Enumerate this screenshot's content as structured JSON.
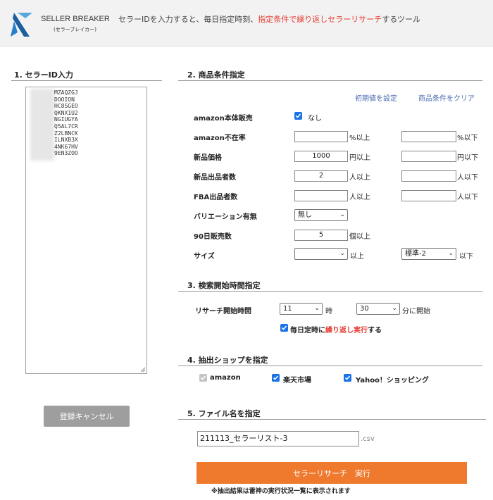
{
  "header": {
    "brand": "SELLER BREAKER",
    "brand_sub": "(セラーブレイカー)",
    "tagline_pre": "セラーIDを入力すると、毎日指定時刻、",
    "tagline_highlight": "指定条件で繰り返しセラーリサーチ",
    "tagline_post": "するツール",
    "accent_color": "#e53a2f"
  },
  "section1": {
    "title": "1. セラーID入力",
    "seller_ids": [
      "MZAQZGJ",
      "DOOION",
      "HC8SGEO",
      "QKNX1U2",
      "NGIUGYA",
      "Q5AL7CR",
      "Z2LBNCK",
      "ILNXB3X",
      "4NK67HV",
      "9EN3ZOO"
    ],
    "cancel_label": "登録キャンセル"
  },
  "section2": {
    "title": "2. 商品条件指定",
    "reset_link": "初期値を設定",
    "clear_link": "商品条件をクリア",
    "amazon_sales": {
      "label": "amazon本体販売",
      "option": "なし",
      "checked": true
    },
    "amazon_absence": {
      "label": "amazon不在率",
      "min": "",
      "min_unit": "%以上",
      "max": "",
      "max_unit": "%以下"
    },
    "new_price": {
      "label": "新品価格",
      "min": "1000",
      "min_unit": "円以上",
      "max": "",
      "max_unit": "円以下"
    },
    "new_sellers": {
      "label": "新品出品者数",
      "min": "2",
      "min_unit": "人以上",
      "max": "",
      "max_unit": "人以下"
    },
    "fba_sellers": {
      "label": "FBA出品者数",
      "min": "",
      "min_unit": "人以上",
      "max": "",
      "max_unit": "人以下"
    },
    "variation": {
      "label": "バリエーション有無",
      "value": "無し"
    },
    "sales_90": {
      "label": "90日販売数",
      "value": "5",
      "unit": "個以上"
    },
    "size": {
      "label": "サイズ",
      "min": "",
      "min_unit": "以上",
      "max": "標準-2",
      "max_unit": "以下"
    }
  },
  "section3": {
    "title": "3. 検索開始時間指定",
    "start_label": "リサーチ開始時間",
    "hour": "11",
    "hour_unit": "時",
    "minute": "30",
    "minute_unit": "分に開始",
    "repeat_pre": "毎日定時に",
    "repeat_highlight": "繰り返し実行",
    "repeat_post": "する",
    "repeat_checked": true
  },
  "section4": {
    "title": "4. 抽出ショップを指定",
    "shops": [
      {
        "label": "amazon",
        "checked": true,
        "disabled": true
      },
      {
        "label": "楽天市場",
        "checked": true,
        "disabled": false
      },
      {
        "label": "Yahoo！ショッピング",
        "checked": true,
        "disabled": false
      }
    ]
  },
  "section5": {
    "title": "5. ファイル名を指定",
    "filename": "211113_セラーリスト-3",
    "extension": ".csv",
    "run_label": "セラーリサーチ　実行",
    "note": "※抽出結果は雷神の実行状況一覧に表示されます",
    "run_color": "#ef7a2e"
  }
}
